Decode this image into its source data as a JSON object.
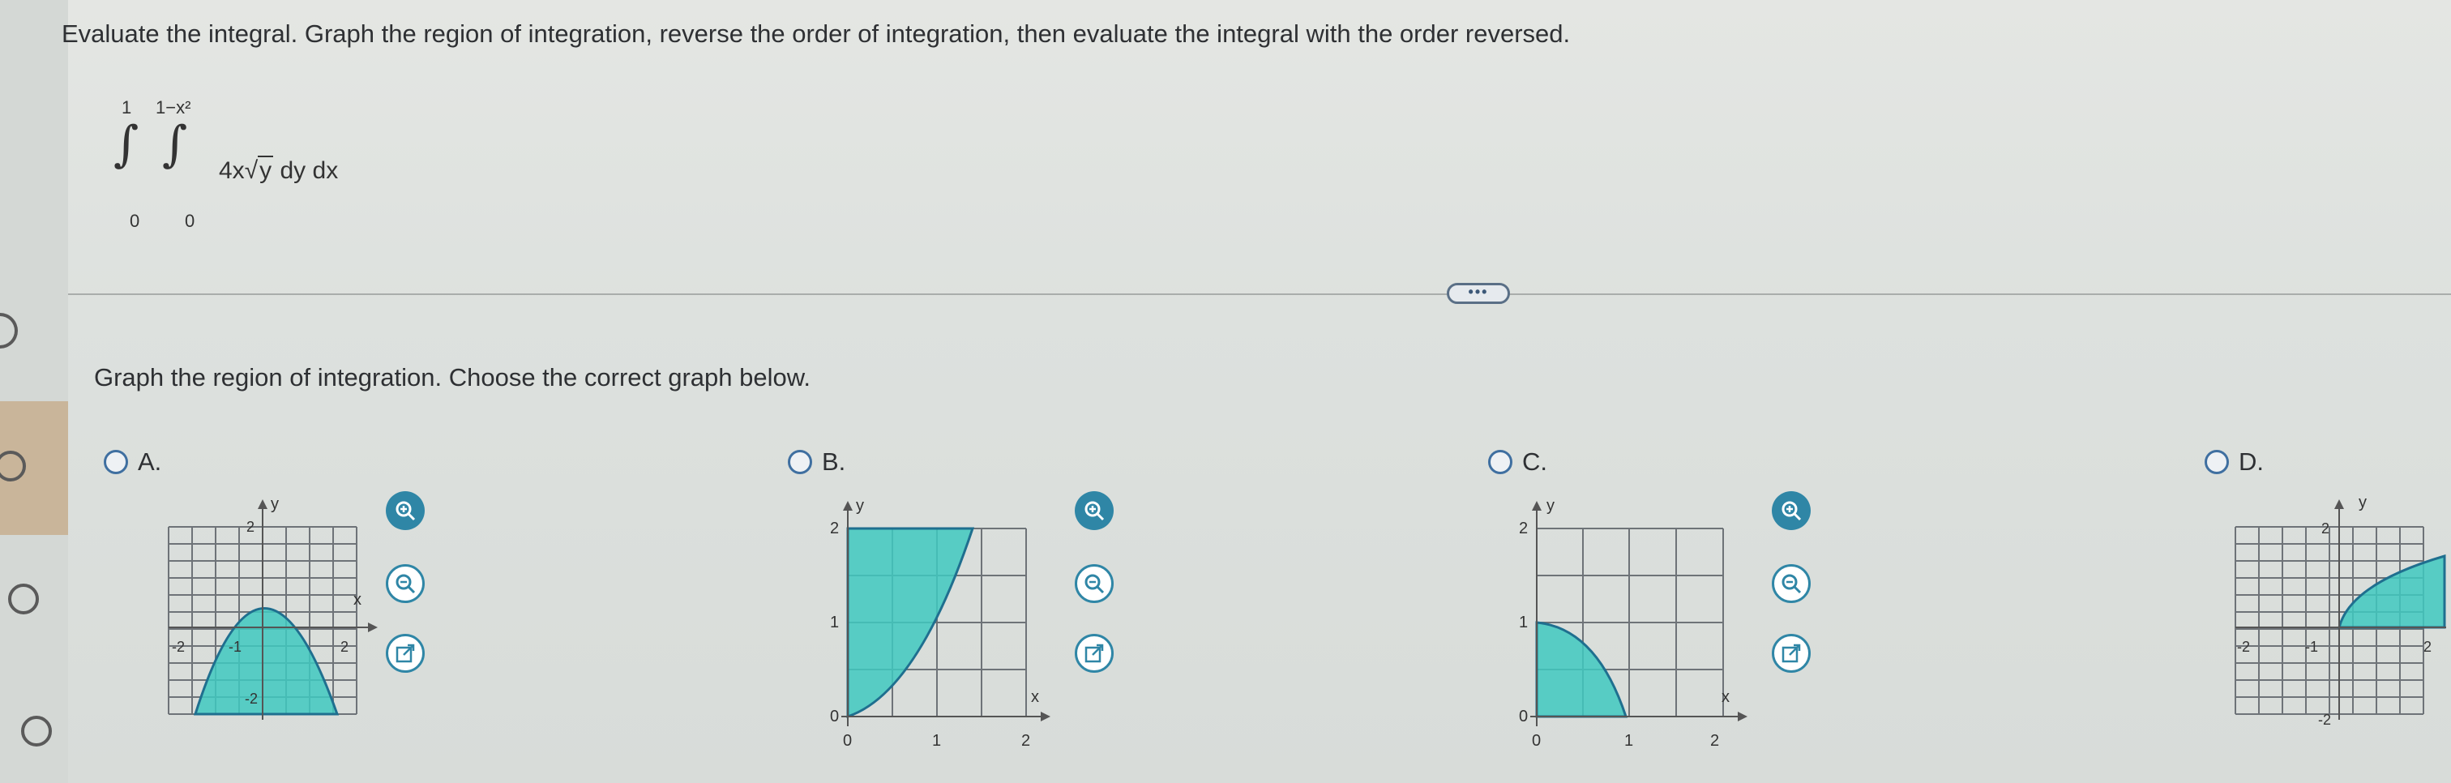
{
  "prompt": "Evaluate the integral. Graph the region of integration, reverse the order of integration, then evaluate the integral with the order reversed.",
  "integral": {
    "outer_upper": "1",
    "outer_lower": "0",
    "inner_upper": "1−x²",
    "inner_lower": "0",
    "integrand_coef": "4x",
    "integrand_radicand": "y",
    "differentials": "dy dx"
  },
  "more_button_label": "•••",
  "question": "Graph the region of integration. Choose the correct graph below.",
  "options": [
    {
      "letter": "A."
    },
    {
      "letter": "B."
    },
    {
      "letter": "C."
    },
    {
      "letter": "D."
    }
  ],
  "axis_labels": {
    "x": "x",
    "y": "y"
  },
  "ticks": {
    "zero": "0",
    "one": "1",
    "two": "2",
    "neg_one": "-1",
    "neg_two": "-2"
  },
  "colors": {
    "region_fill": "#3fc9c0",
    "region_stroke": "#1f6f8f",
    "tool_accent": "#2f86a6",
    "radio": "#3f6fa0"
  },
  "icons": {
    "zoom_in": "zoom-in-icon",
    "zoom_out": "zoom-out-icon",
    "popout": "external-link-icon"
  }
}
